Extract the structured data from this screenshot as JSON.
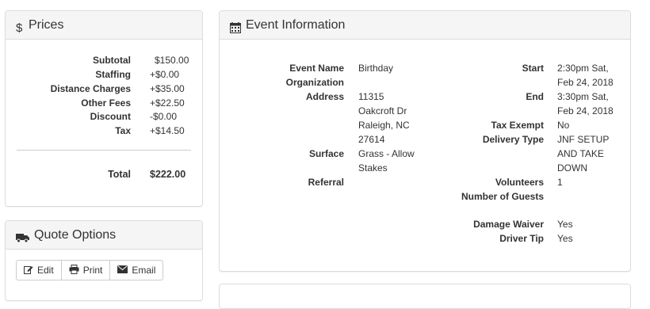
{
  "prices": {
    "title": "Prices",
    "icon": "dollar-icon",
    "rows": [
      {
        "label": "Subtotal",
        "value": "$150.00"
      },
      {
        "label": "Staffing",
        "value": "+$0.00"
      },
      {
        "label": "Distance Charges",
        "value": "+$35.00"
      },
      {
        "label": "Other Fees",
        "value": "+$22.50"
      },
      {
        "label": "Discount",
        "value": "-$0.00"
      },
      {
        "label": "Tax",
        "value": "+$14.50"
      }
    ],
    "total_label": "Total",
    "total_value": "$222.00"
  },
  "quote_options": {
    "title": "Quote Options",
    "icon": "truck-icon",
    "buttons": {
      "edit": {
        "label": "Edit",
        "icon": "edit-icon"
      },
      "print": {
        "label": "Print",
        "icon": "print-icon"
      },
      "email": {
        "label": "Email",
        "icon": "envelope-icon"
      }
    }
  },
  "event": {
    "title": "Event Information",
    "icon": "calendar-icon",
    "left": {
      "event_name": {
        "label": "Event Name",
        "value": "Birthday"
      },
      "organization": {
        "label": "Organization",
        "value": ""
      },
      "address": {
        "label": "Address",
        "lines": [
          "11315",
          "Oakcroft Dr",
          "Raleigh, NC",
          "27614"
        ]
      },
      "surface": {
        "label": "Surface",
        "lines": [
          "Grass - Allow",
          "Stakes"
        ]
      },
      "referral": {
        "label": "Referral",
        "value": ""
      }
    },
    "right": {
      "start": {
        "label": "Start",
        "lines": [
          "2:30pm Sat,",
          "Feb 24, 2018"
        ]
      },
      "end": {
        "label": "End",
        "lines": [
          "3:30pm Sat,",
          "Feb 24, 2018"
        ]
      },
      "tax_exempt": {
        "label": "Tax Exempt",
        "value": "No"
      },
      "delivery_type": {
        "label": "Delivery Type",
        "lines": [
          "JNF SETUP",
          "AND TAKE",
          "DOWN"
        ]
      },
      "volunteers": {
        "label": "Volunteers",
        "value": "1"
      },
      "guests": {
        "label": "Number of Guests",
        "value": ""
      },
      "damage_waiver": {
        "label": "Damage Waiver",
        "value": "Yes"
      },
      "driver_tip": {
        "label": "Driver Tip",
        "value": "Yes"
      }
    }
  },
  "colors": {
    "panel_heading_bg": "#f5f5f5",
    "border": "#dddddd",
    "text": "#333333"
  }
}
